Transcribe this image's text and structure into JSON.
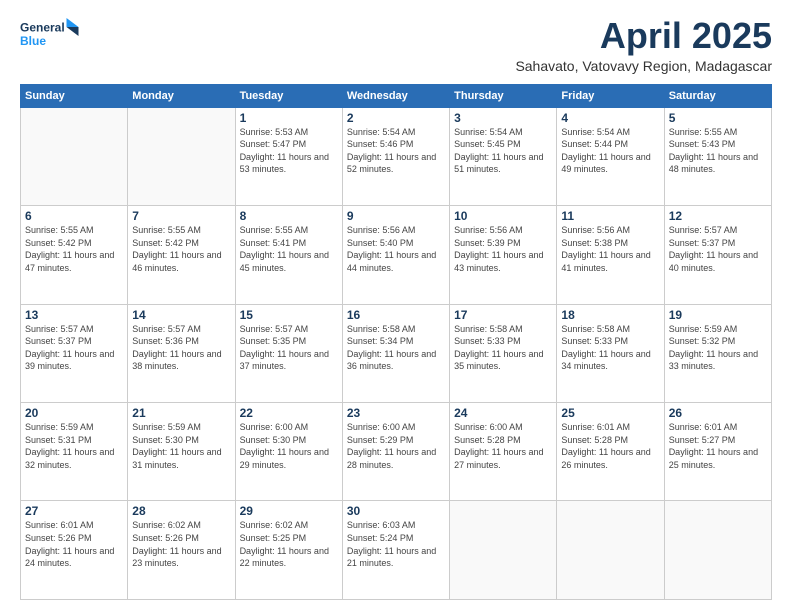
{
  "logo": {
    "line1": "General",
    "line2": "Blue"
  },
  "header": {
    "title": "April 2025",
    "subtitle": "Sahavato, Vatovavy Region, Madagascar"
  },
  "weekdays": [
    "Sunday",
    "Monday",
    "Tuesday",
    "Wednesday",
    "Thursday",
    "Friday",
    "Saturday"
  ],
  "weeks": [
    [
      {
        "day": "",
        "info": ""
      },
      {
        "day": "",
        "info": ""
      },
      {
        "day": "1",
        "info": "Sunrise: 5:53 AM\nSunset: 5:47 PM\nDaylight: 11 hours and 53 minutes."
      },
      {
        "day": "2",
        "info": "Sunrise: 5:54 AM\nSunset: 5:46 PM\nDaylight: 11 hours and 52 minutes."
      },
      {
        "day": "3",
        "info": "Sunrise: 5:54 AM\nSunset: 5:45 PM\nDaylight: 11 hours and 51 minutes."
      },
      {
        "day": "4",
        "info": "Sunrise: 5:54 AM\nSunset: 5:44 PM\nDaylight: 11 hours and 49 minutes."
      },
      {
        "day": "5",
        "info": "Sunrise: 5:55 AM\nSunset: 5:43 PM\nDaylight: 11 hours and 48 minutes."
      }
    ],
    [
      {
        "day": "6",
        "info": "Sunrise: 5:55 AM\nSunset: 5:42 PM\nDaylight: 11 hours and 47 minutes."
      },
      {
        "day": "7",
        "info": "Sunrise: 5:55 AM\nSunset: 5:42 PM\nDaylight: 11 hours and 46 minutes."
      },
      {
        "day": "8",
        "info": "Sunrise: 5:55 AM\nSunset: 5:41 PM\nDaylight: 11 hours and 45 minutes."
      },
      {
        "day": "9",
        "info": "Sunrise: 5:56 AM\nSunset: 5:40 PM\nDaylight: 11 hours and 44 minutes."
      },
      {
        "day": "10",
        "info": "Sunrise: 5:56 AM\nSunset: 5:39 PM\nDaylight: 11 hours and 43 minutes."
      },
      {
        "day": "11",
        "info": "Sunrise: 5:56 AM\nSunset: 5:38 PM\nDaylight: 11 hours and 41 minutes."
      },
      {
        "day": "12",
        "info": "Sunrise: 5:57 AM\nSunset: 5:37 PM\nDaylight: 11 hours and 40 minutes."
      }
    ],
    [
      {
        "day": "13",
        "info": "Sunrise: 5:57 AM\nSunset: 5:37 PM\nDaylight: 11 hours and 39 minutes."
      },
      {
        "day": "14",
        "info": "Sunrise: 5:57 AM\nSunset: 5:36 PM\nDaylight: 11 hours and 38 minutes."
      },
      {
        "day": "15",
        "info": "Sunrise: 5:57 AM\nSunset: 5:35 PM\nDaylight: 11 hours and 37 minutes."
      },
      {
        "day": "16",
        "info": "Sunrise: 5:58 AM\nSunset: 5:34 PM\nDaylight: 11 hours and 36 minutes."
      },
      {
        "day": "17",
        "info": "Sunrise: 5:58 AM\nSunset: 5:33 PM\nDaylight: 11 hours and 35 minutes."
      },
      {
        "day": "18",
        "info": "Sunrise: 5:58 AM\nSunset: 5:33 PM\nDaylight: 11 hours and 34 minutes."
      },
      {
        "day": "19",
        "info": "Sunrise: 5:59 AM\nSunset: 5:32 PM\nDaylight: 11 hours and 33 minutes."
      }
    ],
    [
      {
        "day": "20",
        "info": "Sunrise: 5:59 AM\nSunset: 5:31 PM\nDaylight: 11 hours and 32 minutes."
      },
      {
        "day": "21",
        "info": "Sunrise: 5:59 AM\nSunset: 5:30 PM\nDaylight: 11 hours and 31 minutes."
      },
      {
        "day": "22",
        "info": "Sunrise: 6:00 AM\nSunset: 5:30 PM\nDaylight: 11 hours and 29 minutes."
      },
      {
        "day": "23",
        "info": "Sunrise: 6:00 AM\nSunset: 5:29 PM\nDaylight: 11 hours and 28 minutes."
      },
      {
        "day": "24",
        "info": "Sunrise: 6:00 AM\nSunset: 5:28 PM\nDaylight: 11 hours and 27 minutes."
      },
      {
        "day": "25",
        "info": "Sunrise: 6:01 AM\nSunset: 5:28 PM\nDaylight: 11 hours and 26 minutes."
      },
      {
        "day": "26",
        "info": "Sunrise: 6:01 AM\nSunset: 5:27 PM\nDaylight: 11 hours and 25 minutes."
      }
    ],
    [
      {
        "day": "27",
        "info": "Sunrise: 6:01 AM\nSunset: 5:26 PM\nDaylight: 11 hours and 24 minutes."
      },
      {
        "day": "28",
        "info": "Sunrise: 6:02 AM\nSunset: 5:26 PM\nDaylight: 11 hours and 23 minutes."
      },
      {
        "day": "29",
        "info": "Sunrise: 6:02 AM\nSunset: 5:25 PM\nDaylight: 11 hours and 22 minutes."
      },
      {
        "day": "30",
        "info": "Sunrise: 6:03 AM\nSunset: 5:24 PM\nDaylight: 11 hours and 21 minutes."
      },
      {
        "day": "",
        "info": ""
      },
      {
        "day": "",
        "info": ""
      },
      {
        "day": "",
        "info": ""
      }
    ]
  ]
}
